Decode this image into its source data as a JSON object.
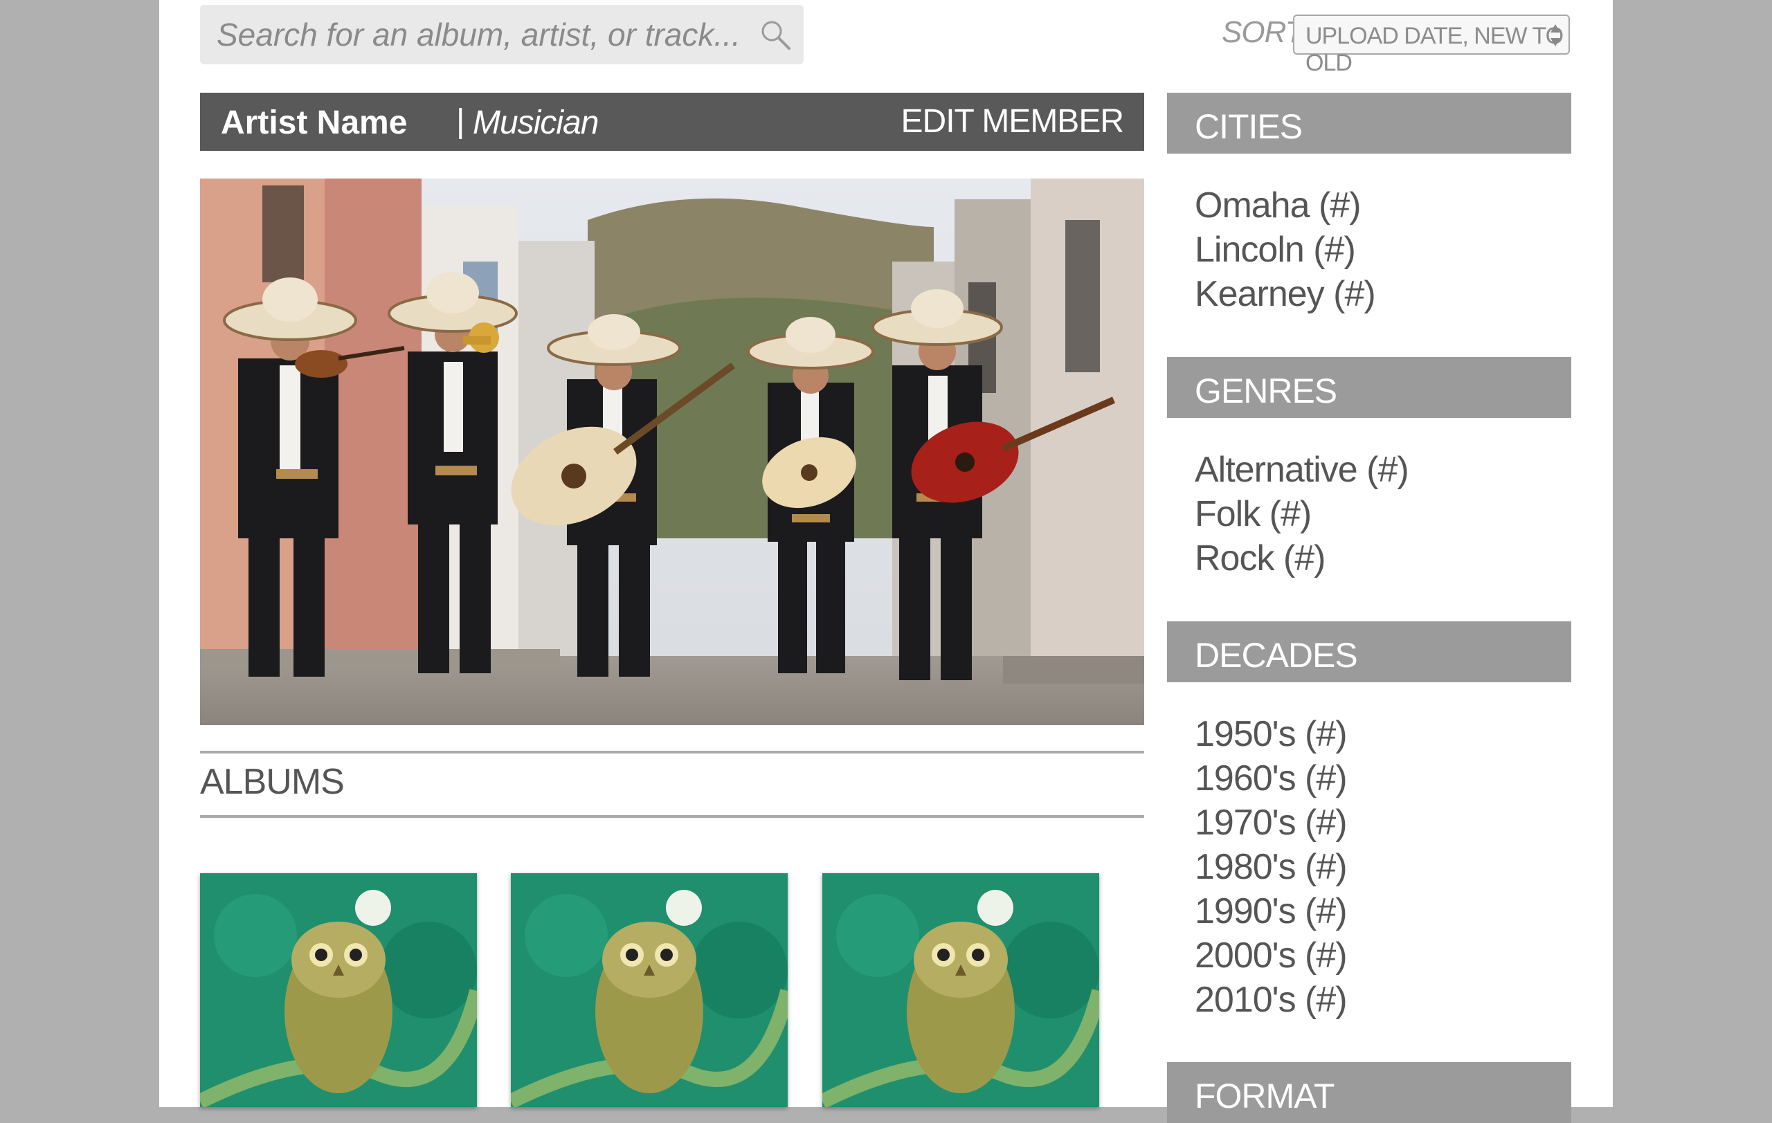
{
  "search": {
    "placeholder": "Search for an album, artist, or track..."
  },
  "sort": {
    "label": "SORT",
    "selected": "UPLOAD DATE, NEW TO OLD"
  },
  "artist": {
    "name": "Artist Name",
    "separator": "|",
    "role": "Musician",
    "edit_label": "EDIT MEMBER"
  },
  "hero": {
    "image": "photo-of-five-mariachi-musicians-walking-down-a-street"
  },
  "albums": {
    "title": "ALBUMS",
    "items": [
      {
        "image": "owl-painting-cover"
      },
      {
        "image": "owl-painting-cover"
      },
      {
        "image": "owl-painting-cover"
      }
    ]
  },
  "filters": {
    "cities": {
      "title": "CITIES",
      "items": [
        "Omaha (#)",
        "Lincoln (#)",
        "Kearney (#)"
      ]
    },
    "genres": {
      "title": "GENRES",
      "items": [
        "Alternative (#)",
        "Folk (#)",
        "Rock (#)"
      ]
    },
    "decades": {
      "title": "DECADES",
      "items": [
        "1950's (#)",
        "1960's (#)",
        "1970's (#)",
        "1980's (#)",
        "1990's (#)",
        "2000's (#)",
        "2010's (#)"
      ]
    },
    "format": {
      "title": "FORMAT"
    }
  },
  "colors": {
    "outer_background": "#b0b0b0",
    "header_bar": "#595959",
    "panel_header": "#9b9b9b",
    "album_green": "#1f8f6e"
  }
}
